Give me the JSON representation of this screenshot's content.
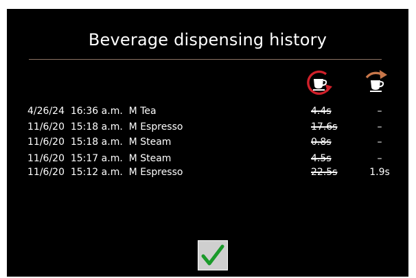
{
  "title": "Beverage dispensing history",
  "columns": {
    "cancelled_icon": "cancelled-cup-icon",
    "retry_icon": "redispense-cup-icon"
  },
  "rows": [
    {
      "entry": "4/26/24  16:36 a.m.  M Tea",
      "time": "4.4s",
      "retry": "–"
    },
    {
      "entry": "11/6/20  15:18 a.m.  M Espresso",
      "time": "17.6s",
      "retry": "–"
    },
    {
      "entry": "11/6/20  15:18 a.m.  M Steam",
      "time": "0.8s",
      "retry": "–"
    },
    {
      "entry": "11/6/20  15:17 a.m.  M Steam",
      "time": "4.5s",
      "retry": "–"
    },
    {
      "entry": "11/6/20  15:12 a.m.  M Espresso",
      "time": "22.5s",
      "retry": "1.9s"
    }
  ],
  "confirm_icon": "checkmark-icon",
  "colors": {
    "background": "#000000",
    "cancel_red": "#d0202a",
    "retry_orange": "#c8774a",
    "confirm_green": "#1a9a2a"
  }
}
